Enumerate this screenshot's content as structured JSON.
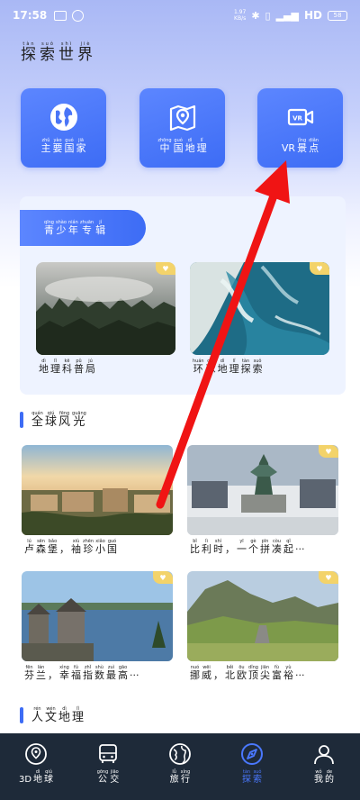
{
  "status_bar": {
    "time": "17:58",
    "net_speed_value": "1.97",
    "net_speed_unit": "KB/s",
    "signal": "HD",
    "battery": "58"
  },
  "page_title": [
    {
      "py": "tàn",
      "hz": "探"
    },
    {
      "py": "suǒ",
      "hz": "索"
    },
    {
      "py": "shì",
      "hz": "世"
    },
    {
      "py": "jiè",
      "hz": "界"
    }
  ],
  "categories": [
    {
      "icon": "globe-icon",
      "label": [
        {
          "py": "zhǔ",
          "hz": "主"
        },
        {
          "py": "yào",
          "hz": "要"
        },
        {
          "py": "guó",
          "hz": "国"
        },
        {
          "py": "jiā",
          "hz": "家"
        }
      ]
    },
    {
      "icon": "map-pin-icon",
      "label": [
        {
          "py": "zhōng",
          "hz": "中"
        },
        {
          "py": "guó",
          "hz": "国"
        },
        {
          "py": "dì",
          "hz": "地"
        },
        {
          "py": "lǐ",
          "hz": "理"
        }
      ]
    },
    {
      "icon": "vr-camera-icon",
      "label": [
        {
          "py": "",
          "hz": "VR"
        },
        {
          "py": "jǐng",
          "hz": "景"
        },
        {
          "py": "diǎn",
          "hz": "点"
        }
      ]
    }
  ],
  "youth_section": {
    "tab_label": [
      {
        "py": "qīng",
        "hz": "青"
      },
      {
        "py": "shào",
        "hz": "少"
      },
      {
        "py": "nián",
        "hz": "年"
      },
      {
        "py": "zhuān",
        "hz": "专"
      },
      {
        "py": "jí",
        "hz": "辑"
      }
    ],
    "cards": [
      {
        "caption": [
          {
            "py": "dì",
            "hz": "地"
          },
          {
            "py": "lǐ",
            "hz": "理"
          },
          {
            "py": "kē",
            "hz": "科"
          },
          {
            "py": "pǔ",
            "hz": "普"
          },
          {
            "py": "jú",
            "hz": "局"
          }
        ]
      },
      {
        "caption": [
          {
            "py": "huán",
            "hz": "环"
          },
          {
            "py": "qiú",
            "hz": "球"
          },
          {
            "py": "dì",
            "hz": "地"
          },
          {
            "py": "lǐ",
            "hz": "理"
          },
          {
            "py": "tàn",
            "hz": "探"
          },
          {
            "py": "suǒ",
            "hz": "索"
          }
        ]
      }
    ]
  },
  "global_scenery": {
    "heading": [
      {
        "py": "quán",
        "hz": "全"
      },
      {
        "py": "qiú",
        "hz": "球"
      },
      {
        "py": "fēng",
        "hz": "风"
      },
      {
        "py": "guāng",
        "hz": "光"
      }
    ],
    "items": [
      {
        "caption": [
          {
            "py": "lú",
            "hz": "卢"
          },
          {
            "py": "sēn",
            "hz": "森"
          },
          {
            "py": "bǎo",
            "hz": "堡"
          },
          {
            "py": "",
            "hz": "，"
          },
          {
            "py": "xiù",
            "hz": "袖"
          },
          {
            "py": "zhēn",
            "hz": "珍"
          },
          {
            "py": "xiǎo",
            "hz": "小"
          },
          {
            "py": "guó",
            "hz": "国"
          }
        ]
      },
      {
        "caption": [
          {
            "py": "bǐ",
            "hz": "比"
          },
          {
            "py": "lì",
            "hz": "利"
          },
          {
            "py": "shí",
            "hz": "时"
          },
          {
            "py": "",
            "hz": "，"
          },
          {
            "py": "yī",
            "hz": "一"
          },
          {
            "py": "gè",
            "hz": "个"
          },
          {
            "py": "pīn",
            "hz": "拼"
          },
          {
            "py": "còu",
            "hz": "凑"
          },
          {
            "py": "qǐ",
            "hz": "起"
          },
          {
            "py": "",
            "hz": "···"
          }
        ]
      },
      {
        "caption": [
          {
            "py": "fēn",
            "hz": "芬"
          },
          {
            "py": "lán",
            "hz": "兰"
          },
          {
            "py": "",
            "hz": "，"
          },
          {
            "py": "xìng",
            "hz": "幸"
          },
          {
            "py": "fú",
            "hz": "福"
          },
          {
            "py": "zhǐ",
            "hz": "指"
          },
          {
            "py": "shù",
            "hz": "数"
          },
          {
            "py": "zuì",
            "hz": "最"
          },
          {
            "py": "gāo",
            "hz": "高"
          },
          {
            "py": "",
            "hz": "···"
          }
        ]
      },
      {
        "caption": [
          {
            "py": "nuó",
            "hz": "挪"
          },
          {
            "py": "wēi",
            "hz": "威"
          },
          {
            "py": "",
            "hz": "，"
          },
          {
            "py": "běi",
            "hz": "北"
          },
          {
            "py": "ōu",
            "hz": "欧"
          },
          {
            "py": "dǐng",
            "hz": "顶"
          },
          {
            "py": "jiān",
            "hz": "尖"
          },
          {
            "py": "fù",
            "hz": "富"
          },
          {
            "py": "yù",
            "hz": "裕"
          },
          {
            "py": "",
            "hz": "···"
          }
        ]
      }
    ]
  },
  "humanities": {
    "heading": [
      {
        "py": "rén",
        "hz": "人"
      },
      {
        "py": "wén",
        "hz": "文"
      },
      {
        "py": "dì",
        "hz": "地"
      },
      {
        "py": "lǐ",
        "hz": "理"
      }
    ]
  },
  "bottom_nav": [
    {
      "icon": "globe-pin-icon",
      "label": [
        {
          "py": "",
          "hz": "3D"
        },
        {
          "py": "dì",
          "hz": "地"
        },
        {
          "py": "qiú",
          "hz": "球"
        }
      ],
      "active": false
    },
    {
      "icon": "bus-icon",
      "label": [
        {
          "py": "gōng",
          "hz": "公"
        },
        {
          "py": "jiāo",
          "hz": "交"
        }
      ],
      "active": false
    },
    {
      "icon": "travel-globe-icon",
      "label": [
        {
          "py": "lǚ",
          "hz": "旅"
        },
        {
          "py": "xíng",
          "hz": "行"
        }
      ],
      "active": false
    },
    {
      "icon": "explore-icon",
      "label": [
        {
          "py": "tàn",
          "hz": "探"
        },
        {
          "py": "suǒ",
          "hz": "索"
        }
      ],
      "active": true
    },
    {
      "icon": "profile-icon",
      "label": [
        {
          "py": "wǒ",
          "hz": "我"
        },
        {
          "py": "de",
          "hz": "的"
        }
      ],
      "active": false
    }
  ],
  "colors": {
    "accent": "#3d6cf5",
    "nav_bg": "#1e2a39",
    "badge": "#f3d36a",
    "annotation_arrow": "#f01414"
  }
}
